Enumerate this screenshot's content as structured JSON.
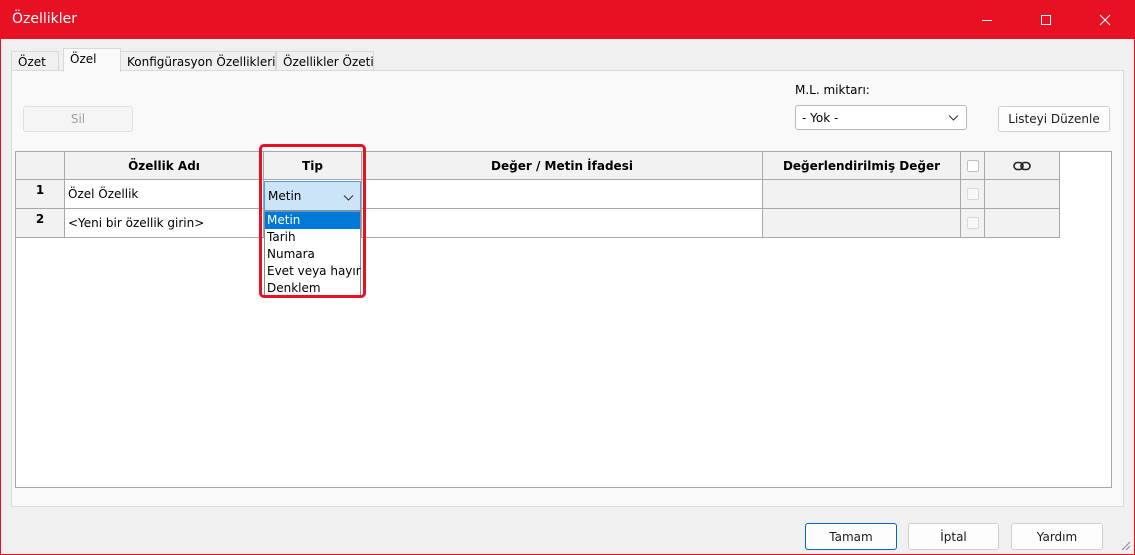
{
  "window": {
    "title": "Özellikler",
    "controls": {
      "minimize": "minimize-icon",
      "maximize": "maximize-icon",
      "close": "close-icon"
    }
  },
  "tabs": [
    {
      "label": "Özet",
      "active": false
    },
    {
      "label": "Özel",
      "active": true
    },
    {
      "label": "Konfigürasyon Özellikleri",
      "active": false
    },
    {
      "label": "Özellikler Özeti",
      "active": false
    }
  ],
  "toolbar": {
    "delete_label": "Sil",
    "ml_label": "M.L. miktarı:",
    "ml_value": "- Yok -",
    "edit_list_label": "Listeyi Düzenle"
  },
  "grid": {
    "headers": {
      "name": "Özellik Adı",
      "type": "Tip",
      "value": "Değer / Metin İfadesi",
      "evaluated": "Değerlendirilmiş Değer",
      "link_icon": "link-icon"
    },
    "rows": [
      {
        "num": "1",
        "name": "Özel Özellik",
        "type": "Metin",
        "value": "",
        "evaluated": ""
      },
      {
        "num": "2",
        "name": "<Yeni bir özellik girin>",
        "type": "",
        "value": "",
        "evaluated": ""
      }
    ]
  },
  "type_dropdown": {
    "selected": "Metin",
    "options": [
      "Metin",
      "Tarih",
      "Numara",
      "Evet veya hayır",
      "Denklem"
    ],
    "highlighted_index": 0
  },
  "footer": {
    "ok_label": "Tamam",
    "cancel_label": "İptal",
    "help_label": "Yardım"
  },
  "colors": {
    "accent": "#e81123",
    "selection": "#0078d7"
  }
}
